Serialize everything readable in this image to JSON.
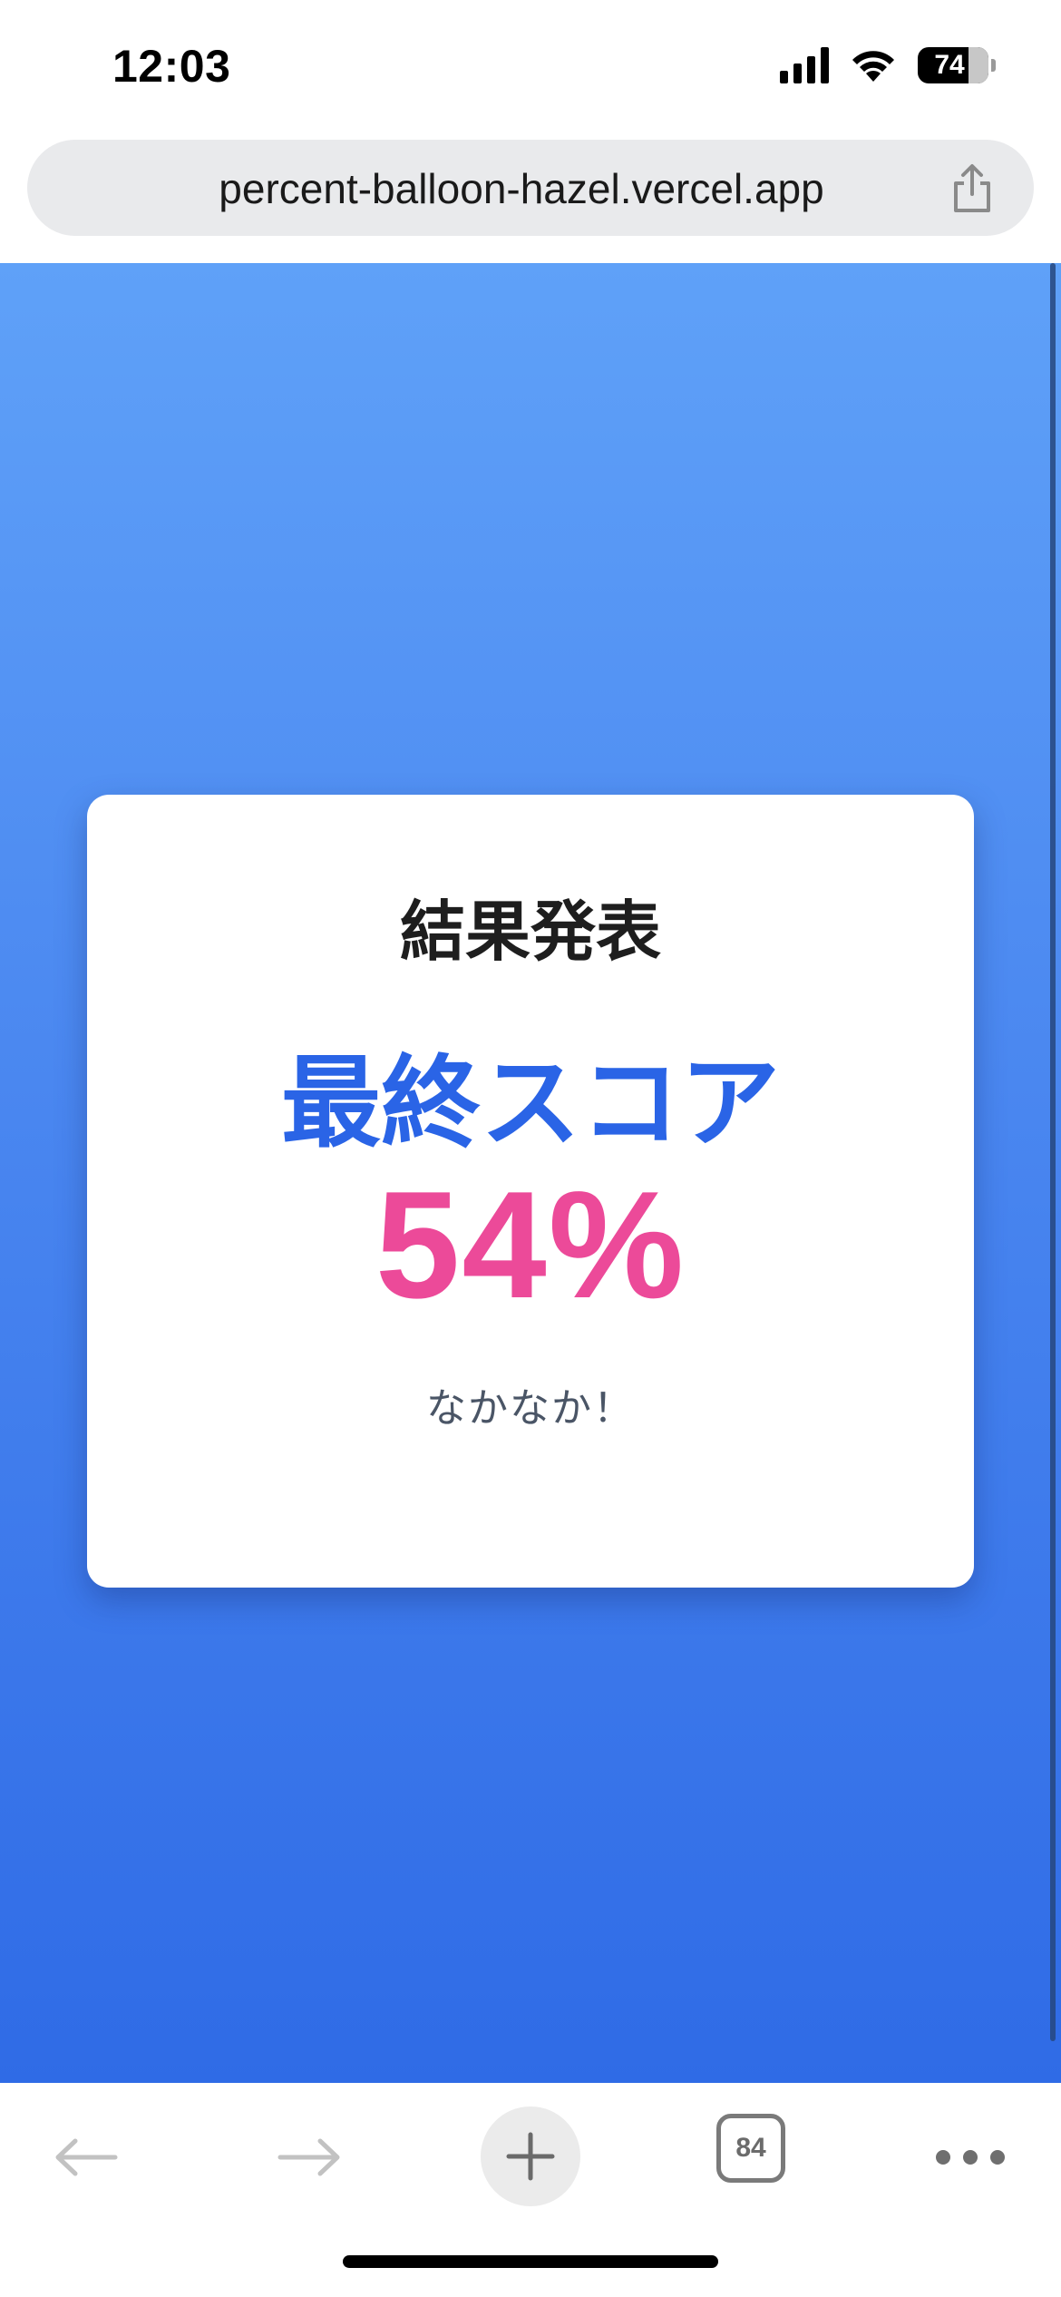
{
  "status_bar": {
    "time": "12:03",
    "battery_level": "74",
    "icons": [
      "cellular-signal-icon",
      "wifi-icon",
      "battery-icon"
    ]
  },
  "browser": {
    "url": "percent-balloon-hazel.vercel.app",
    "tab_count": "84",
    "toolbar_icons": [
      "back-arrow-icon",
      "forward-arrow-icon",
      "plus-icon",
      "tabs-icon",
      "more-icon"
    ]
  },
  "result_card": {
    "heading": "結果発表",
    "subheading": "最終スコア",
    "score": "54%",
    "score_value": 54,
    "comment": "なかなか！"
  },
  "colors": {
    "background_top": "#5fa1f8",
    "background_bottom": "#2f6be6",
    "subheading": "#2a64e6",
    "score": "#ec4a99",
    "comment": "#4a5566"
  }
}
